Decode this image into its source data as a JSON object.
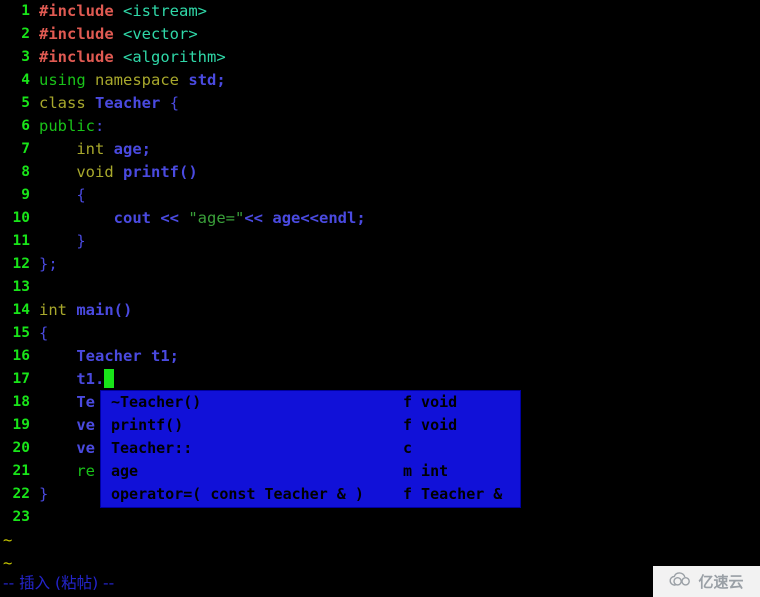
{
  "editor": {
    "app": "vim",
    "colors": {
      "background": "#000000",
      "line_number": "#19e519",
      "preprocessor": "#e05a52",
      "include_path": "#2fd8a8",
      "keyword": "#19c219",
      "type": "#a8a82c",
      "identifier": "#4a4ae0",
      "string": "#3aa03a",
      "cursor": "#19e519",
      "popup_background": "#1111d8",
      "popup_text": "#000000",
      "tilde": "#c8c800",
      "status_text": "#2424cc"
    },
    "lines": [
      {
        "number": "1",
        "tokens": [
          {
            "text": "#include",
            "style": "t-pre"
          },
          {
            "text": " ",
            "style": "t-plain"
          },
          {
            "text": "<istream>",
            "style": "t-inc"
          }
        ]
      },
      {
        "number": "2",
        "tokens": [
          {
            "text": "#include",
            "style": "t-pre"
          },
          {
            "text": " ",
            "style": "t-plain"
          },
          {
            "text": "<vector>",
            "style": "t-inc"
          }
        ]
      },
      {
        "number": "3",
        "tokens": [
          {
            "text": "#include",
            "style": "t-pre"
          },
          {
            "text": " ",
            "style": "t-plain"
          },
          {
            "text": "<algorithm>",
            "style": "t-inc"
          }
        ]
      },
      {
        "number": "4",
        "tokens": [
          {
            "text": "using",
            "style": "t-kw"
          },
          {
            "text": " ",
            "style": "t-plain"
          },
          {
            "text": "namespace",
            "style": "t-type"
          },
          {
            "text": " ",
            "style": "t-plain"
          },
          {
            "text": "std;",
            "style": "t-id"
          }
        ]
      },
      {
        "number": "5",
        "tokens": [
          {
            "text": "class",
            "style": "t-type"
          },
          {
            "text": " ",
            "style": "t-plain"
          },
          {
            "text": "Teacher",
            "style": "t-id"
          },
          {
            "text": " ",
            "style": "t-plain"
          },
          {
            "text": "{",
            "style": "t-punct"
          }
        ]
      },
      {
        "number": "6",
        "tokens": [
          {
            "text": "public",
            "style": "t-kw"
          },
          {
            "text": ":",
            "style": "t-punct"
          }
        ]
      },
      {
        "number": "7",
        "tokens": [
          {
            "text": "    ",
            "style": "t-plain"
          },
          {
            "text": "int",
            "style": "t-type"
          },
          {
            "text": " ",
            "style": "t-plain"
          },
          {
            "text": "age;",
            "style": "t-id"
          }
        ]
      },
      {
        "number": "8",
        "tokens": [
          {
            "text": "    ",
            "style": "t-plain"
          },
          {
            "text": "void",
            "style": "t-type"
          },
          {
            "text": " ",
            "style": "t-plain"
          },
          {
            "text": "printf()",
            "style": "t-id"
          }
        ]
      },
      {
        "number": "9",
        "tokens": [
          {
            "text": "    ",
            "style": "t-plain"
          },
          {
            "text": "{",
            "style": "t-punct"
          }
        ]
      },
      {
        "number": "10",
        "tokens": [
          {
            "text": "        ",
            "style": "t-plain"
          },
          {
            "text": "cout",
            "style": "t-id"
          },
          {
            "text": " ",
            "style": "t-plain"
          },
          {
            "text": "<<",
            "style": "t-id"
          },
          {
            "text": " ",
            "style": "t-plain"
          },
          {
            "text": "\"age=\"",
            "style": "t-str"
          },
          {
            "text": "<<",
            "style": "t-id"
          },
          {
            "text": " ",
            "style": "t-plain"
          },
          {
            "text": "age<<endl;",
            "style": "t-id"
          }
        ]
      },
      {
        "number": "11",
        "tokens": [
          {
            "text": "    ",
            "style": "t-plain"
          },
          {
            "text": "}",
            "style": "t-punct"
          }
        ]
      },
      {
        "number": "12",
        "tokens": [
          {
            "text": "};",
            "style": "t-punct"
          }
        ]
      },
      {
        "number": "13",
        "tokens": []
      },
      {
        "number": "14",
        "tokens": [
          {
            "text": "int",
            "style": "t-type"
          },
          {
            "text": " ",
            "style": "t-plain"
          },
          {
            "text": "main()",
            "style": "t-id"
          }
        ]
      },
      {
        "number": "15",
        "tokens": [
          {
            "text": "{",
            "style": "t-punct"
          }
        ]
      },
      {
        "number": "16",
        "tokens": [
          {
            "text": "    ",
            "style": "t-plain"
          },
          {
            "text": "Teacher t1;",
            "style": "t-id"
          }
        ]
      },
      {
        "number": "17",
        "tokens": [
          {
            "text": "    ",
            "style": "t-plain"
          },
          {
            "text": "t1.",
            "style": "t-id"
          }
        ],
        "cursor": true
      },
      {
        "number": "18",
        "tokens": [
          {
            "text": "    ",
            "style": "t-plain"
          },
          {
            "text": "Te",
            "style": "t-id"
          }
        ]
      },
      {
        "number": "19",
        "tokens": [
          {
            "text": "    ",
            "style": "t-plain"
          },
          {
            "text": "ve",
            "style": "t-id"
          }
        ]
      },
      {
        "number": "20",
        "tokens": [
          {
            "text": "    ",
            "style": "t-plain"
          },
          {
            "text": "ve",
            "style": "t-id"
          }
        ]
      },
      {
        "number": "21",
        "tokens": [
          {
            "text": "    ",
            "style": "t-plain"
          },
          {
            "text": "re",
            "style": "t-kw"
          }
        ]
      },
      {
        "number": "22",
        "tokens": [
          {
            "text": "}",
            "style": "t-punct"
          }
        ]
      },
      {
        "number": "23",
        "tokens": []
      }
    ],
    "filler_lines": [
      "~",
      "~"
    ],
    "completion_popup": {
      "visible": true,
      "items": [
        {
          "name": "~Teacher()",
          "kind": "f void"
        },
        {
          "name": "printf()",
          "kind": "f void"
        },
        {
          "name": "Teacher::",
          "kind": "c"
        },
        {
          "name": "age",
          "kind": "m int"
        },
        {
          "name": "operator=( const Teacher & )",
          "kind": "f Teacher &"
        }
      ]
    },
    "status_line": "-- 插入 (粘帖) --"
  },
  "watermark": {
    "text": "亿速云",
    "icon": "cloud-icon"
  }
}
